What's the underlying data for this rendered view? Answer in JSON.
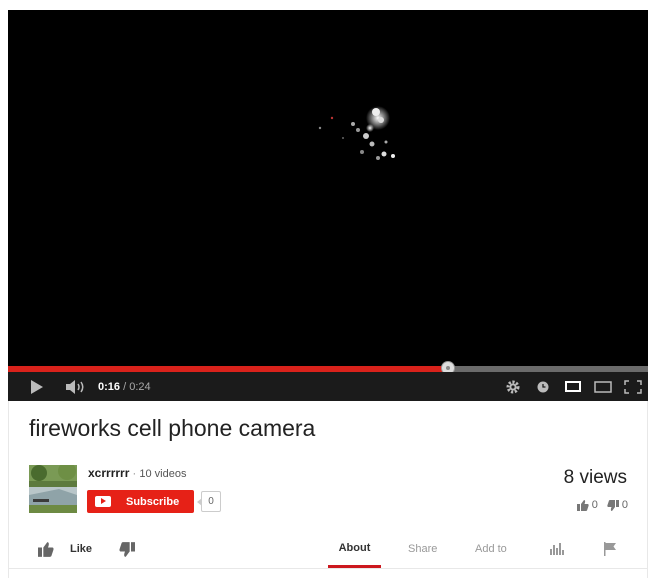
{
  "player": {
    "current_time": "0:16",
    "duration": "/ 0:24",
    "progress_fraction": 0.6875,
    "colors": {
      "progress": "#d9221b",
      "background": "#000000"
    }
  },
  "video": {
    "title": "fireworks cell phone camera",
    "views": "8 views",
    "likes": "0",
    "dislikes": "0"
  },
  "channel": {
    "name": "xcrrrrrr",
    "separator": "·",
    "video_count": "10 videos",
    "subscribe_label": "Subscribe",
    "subscriber_count": "0"
  },
  "actions": {
    "like_label": "Like",
    "tabs": [
      {
        "label": "About",
        "active": true
      },
      {
        "label": "Share",
        "active": false
      },
      {
        "label": "Add to",
        "active": false
      }
    ]
  },
  "icons": [
    "play-icon",
    "volume-icon",
    "gear-icon",
    "clock-icon",
    "small-player-icon",
    "large-player-icon",
    "fullscreen-icon",
    "thumbs-up-icon",
    "thumbs-down-icon",
    "stats-icon",
    "flag-icon",
    "youtube-logo-icon"
  ]
}
